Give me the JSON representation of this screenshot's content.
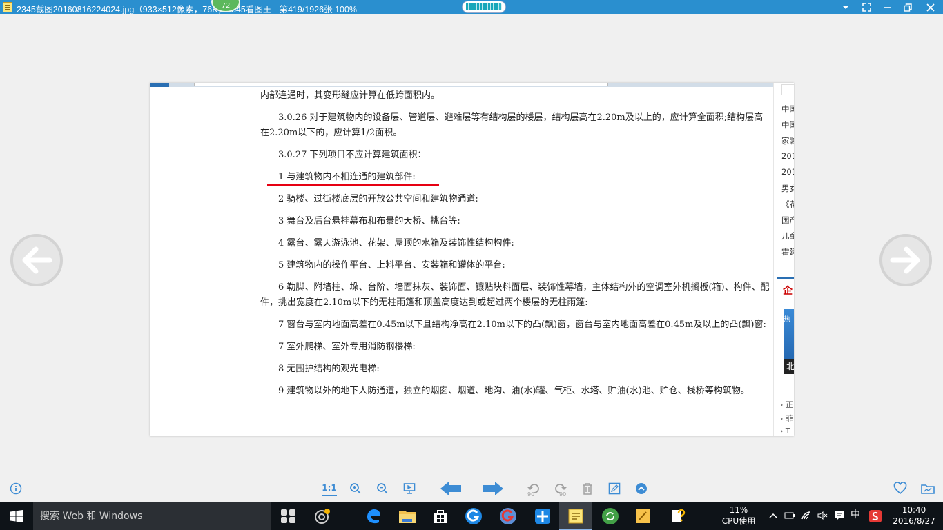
{
  "window": {
    "title": "2345截图20160816224024.jpg（933×512像素，76K，2345看图王 - 第419/1926张 100%",
    "speed_badge": "72",
    "progress": 0.92
  },
  "viewer": {
    "prev_icon": "arrow-left-icon",
    "next_icon": "arrow-right-icon"
  },
  "document": {
    "paragraphs": [
      "内部连通时，其变形缝应计算在低跨面积内。",
      "3.0.26 对于建筑物内的设备层、管道层、避难层等有结构层的楼层，结构层高在2.20m及以上的，应计算全面积;结构层高在2.20m以下的，应计算1/2面积。",
      "3.0.27 下列项目不应计算建筑面积：",
      "1 与建筑物内不相连通的建筑部件:",
      "2 骑楼、过街楼底层的开放公共空间和建筑物通道:",
      "3 舞台及后台悬挂幕布和布景的天桥、挑台等:",
      "4 露台、露天游泳池、花架、屋顶的水箱及装饰性结构构件:",
      "5 建筑物内的操作平台、上料平台、安装箱和罐体的平台:",
      "6 勒脚、附墙柱、垛、台阶、墙面抹灰、装饰面、镶贴块料面层、装饰性幕墙，主体结构外的空调室外机搁板(箱)、构件、配件，挑出宽度在2.10m以下的无柱雨篷和顶盖高度达到或超过两个楼层的无柱雨篷:",
      "7 窗台与室内地面高差在0.45m以下且结构净高在2.10m以下的凸(飘)窗，窗台与室内地面高差在0.45m及以上的凸(飘)窗:",
      "7 室外爬梯、室外专用消防钢楼梯:",
      "8 无围护结构的观光电梯:",
      "9 建筑物以外的地下人防通道，独立的烟囱、烟道、地沟、油(水)罐、气柜、水塔、贮油(水)池、贮仓、栈桥等构筑物。"
    ],
    "accent_color": "#e60012"
  },
  "side_panel": {
    "items": [
      "中国",
      "中国",
      "家装",
      "201",
      "201",
      "男女",
      "《花",
      "国产",
      "儿童",
      "霍建"
    ],
    "header": "企",
    "ad_top": "热",
    "ad_bottom": "北",
    "links": [
      "正",
      "菲",
      "T"
    ]
  },
  "toolbar": {
    "actual_size_label": "1:1",
    "rotate_left_label": "90",
    "rotate_right_label": "90",
    "color": "#3d8cd4"
  },
  "taskbar": {
    "search_placeholder": "搜索 Web 和 Windows",
    "cpu_percent": "11%",
    "cpu_label": "CPU使用",
    "ime": "中",
    "time": "10:40",
    "date": "2016/8/27"
  }
}
